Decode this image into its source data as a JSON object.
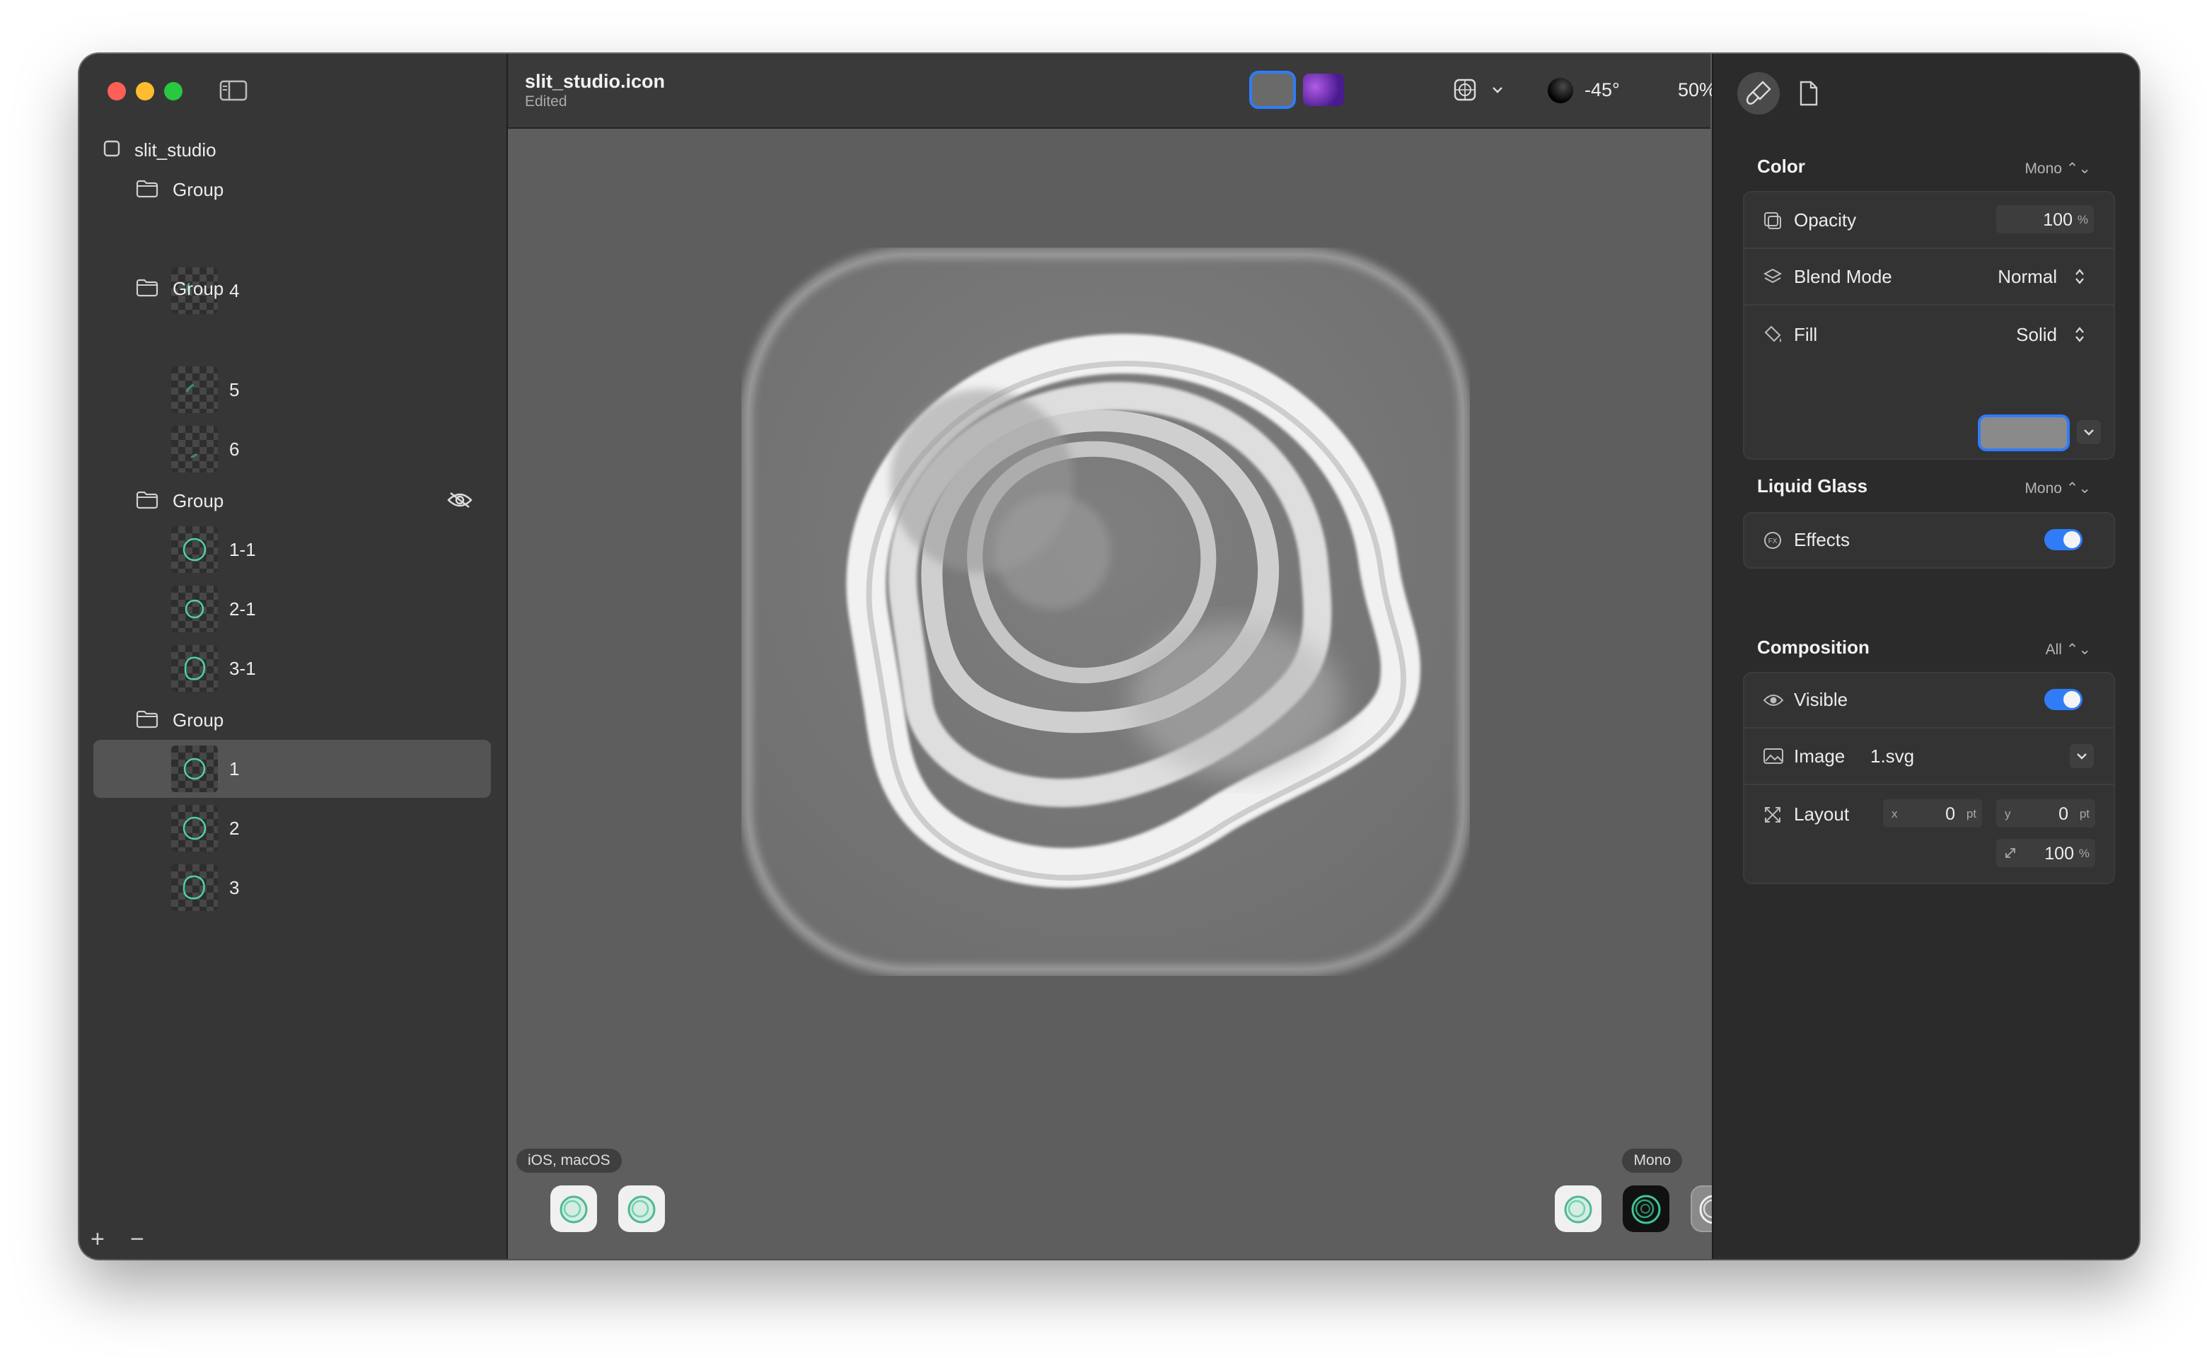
{
  "window": {
    "document_title": "slit_studio.icon",
    "document_status": "Edited"
  },
  "sidebar": {
    "root": {
      "label": "slit_studio",
      "icon": "square-icon"
    },
    "groups": [
      {
        "label": "Group",
        "hidden": false,
        "layers": [
          "4"
        ]
      },
      {
        "label": "Group",
        "hidden": false,
        "layers": [
          "5",
          "6"
        ]
      },
      {
        "label": "Group",
        "hidden": true,
        "layers": [
          "1-1",
          "2-1",
          "3-1"
        ]
      },
      {
        "label": "Group",
        "hidden": false,
        "layers": [
          "1",
          "2",
          "3"
        ]
      }
    ],
    "selected_layer": "1",
    "add_label": "+",
    "remove_label": "−"
  },
  "toolbar": {
    "appearance_modes": [
      "light",
      "tinted"
    ],
    "light_angle": "-45°",
    "zoom": "50%"
  },
  "canvas": {
    "left_badge": "iOS, macOS",
    "right_badge": "Mono",
    "left_previews": [
      "default",
      "default-alt"
    ],
    "right_previews": [
      "default",
      "dark",
      "mono"
    ]
  },
  "inspector": {
    "color": {
      "title": "Color",
      "mode": "Mono",
      "opacity_label": "Opacity",
      "opacity_value": "100",
      "opacity_unit": "%",
      "blend_label": "Blend Mode",
      "blend_value": "Normal",
      "fill_label": "Fill",
      "fill_value": "Solid",
      "fill_color": "#8a8a8a"
    },
    "liquid_glass": {
      "title": "Liquid Glass",
      "mode": "Mono",
      "effects_label": "Effects",
      "effects_on": true
    },
    "composition": {
      "title": "Composition",
      "mode": "All",
      "visible_label": "Visible",
      "visible_on": true,
      "image_label": "Image",
      "image_value": "1.svg",
      "layout_label": "Layout",
      "x_label": "x",
      "x_value": "0",
      "y_label": "y",
      "y_value": "0",
      "pt_unit": "pt",
      "scale_value": "100",
      "scale_unit": "%"
    }
  },
  "colors": {
    "accent": "#2f7cf6",
    "sidebar_bg": "#363636",
    "canvas_bg": "#5e5e5e",
    "inspector_bg": "#2b2b2b",
    "teal_glyph": "#4fd1a5"
  }
}
